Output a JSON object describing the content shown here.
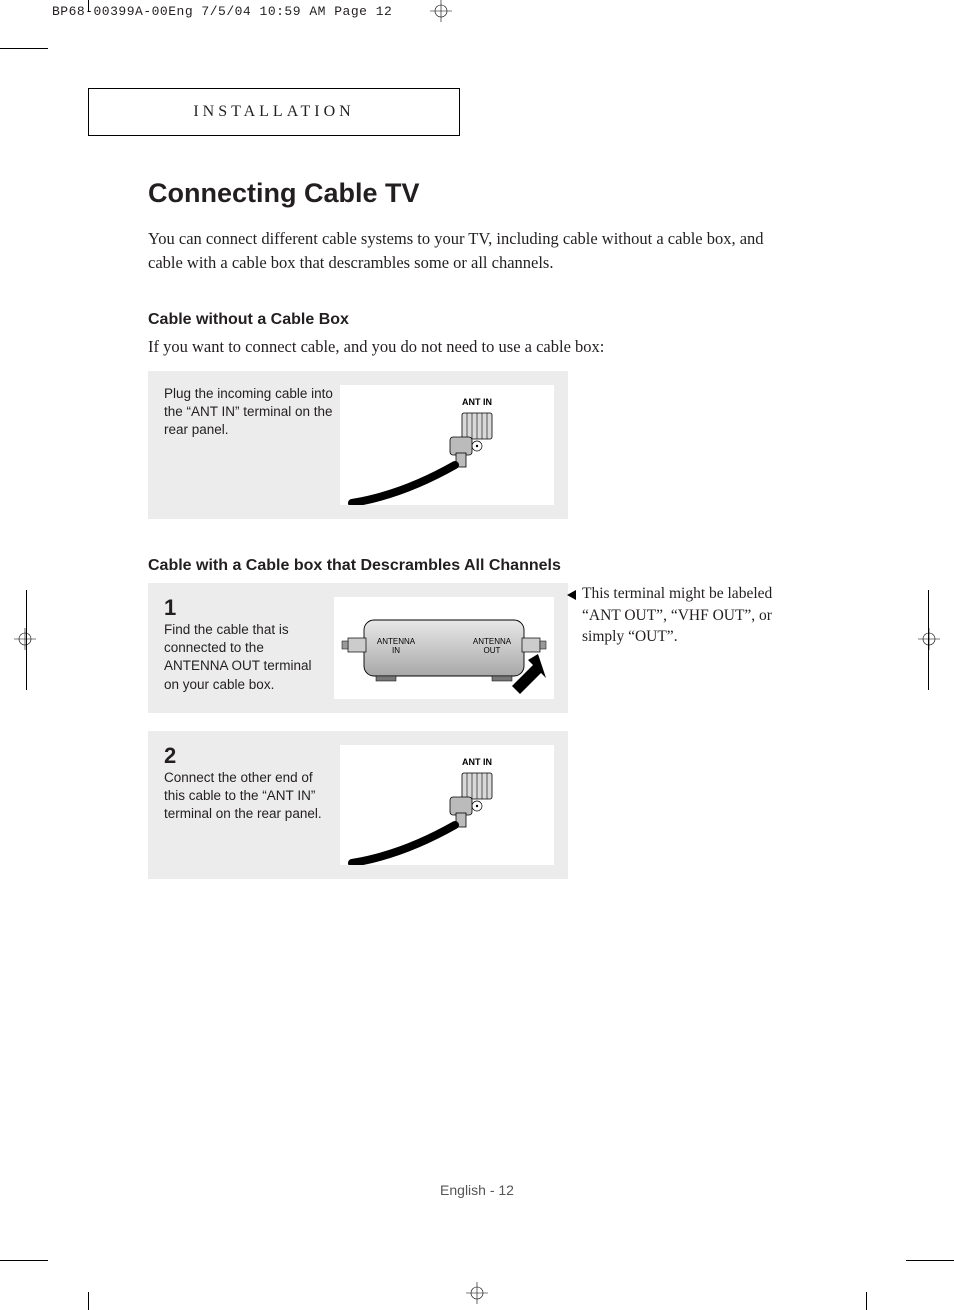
{
  "print_meta": "BP68-00399A-00Eng  7/5/04  10:59 AM  Page 12",
  "section_tab": "INSTALLATION",
  "title": "Connecting Cable TV",
  "intro": "You can connect different cable systems to your TV, including cable without a cable box, and cable with a cable box that descrambles some or all channels.",
  "sub1_heading": "Cable without a Cable Box",
  "sub1_intro": "If you want to connect cable, and you do not need to use a cable box:",
  "sub1_step_text": "Plug the incoming cable into the “ANT IN” terminal on the rear panel.",
  "sub2_heading": "Cable with a Cable box that Descrambles All Channels",
  "sub2_step1_num": "1",
  "sub2_step1_text": "Find the cable that is connected to the ANTENNA OUT terminal on your cable box.",
  "sub2_step1_note": "This terminal might be labeled “ANT OUT”, “VHF OUT”, or simply “OUT”.",
  "sub2_step2_num": "2",
  "sub2_step2_text": "Connect the other end of this cable to the “ANT IN” terminal on the rear panel.",
  "fig_labels": {
    "ant_in": "ANT IN",
    "antenna_in": "ANTENNA\nIN",
    "antenna_out": "ANTENNA\nOUT"
  },
  "footer": "English - 12"
}
